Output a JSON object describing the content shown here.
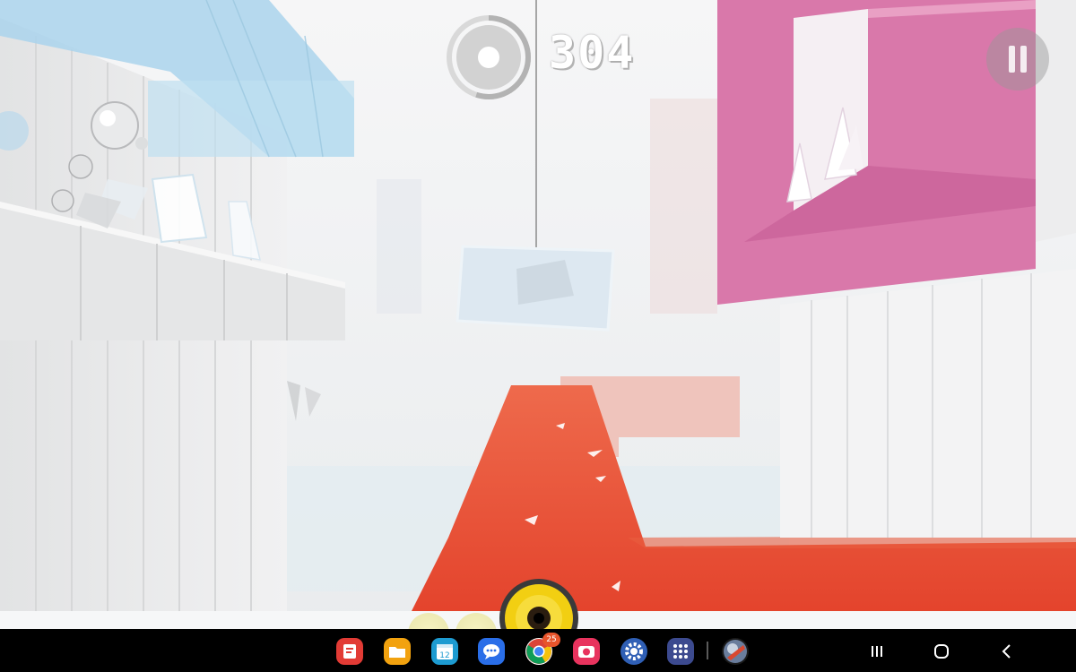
{
  "hud": {
    "score": "304",
    "ball_meter_fraction": 0.55,
    "ammo_balls_visible": 3
  },
  "colors": {
    "path_red": "#e4462b",
    "pink_block": "#d772a5",
    "blue_block": "#a9d3ea",
    "fire_yellow": "#f2cf12"
  },
  "taskbar": {
    "apps": [
      {
        "name": "notes-app-icon"
      },
      {
        "name": "my-files-icon"
      },
      {
        "name": "calendar-icon",
        "label": "12"
      },
      {
        "name": "messages-icon"
      },
      {
        "name": "chrome-icon",
        "badge": "25"
      },
      {
        "name": "camera-icon"
      },
      {
        "name": "settings-icon"
      },
      {
        "name": "app-drawer-icon"
      },
      {
        "name": "smash-hit-icon"
      }
    ],
    "nav": [
      "recents-button",
      "home-button",
      "back-button"
    ]
  }
}
